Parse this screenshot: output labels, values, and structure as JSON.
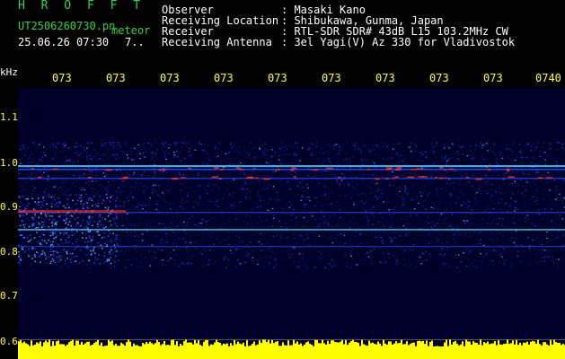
{
  "header": {
    "brand": "H R O F F T",
    "filename": "UT2506260730.pn",
    "meteor_label": "meteor",
    "date_time": "25.06.26 07:30",
    "extra": "7.."
  },
  "info": [
    {
      "key": "Observer",
      "value": ": Masaki Kano"
    },
    {
      "key": "Receiving Location",
      "value": ": Shibukawa, Gunma, Japan"
    },
    {
      "key": "Receiver",
      "value": ": RTL-SDR SDR# 43dB L15 103.2MHz CW"
    },
    {
      "key": "Receiving Antenna",
      "value": ": 3el Yagi(V) Az 330 for Vladivostok"
    }
  ],
  "axis": {
    "y_unit": "kHz",
    "y_ticks": [
      "1.1",
      "1.0",
      "0.9",
      "0.8",
      "0.7",
      "0.6"
    ],
    "x_ticks": [
      "073",
      "073",
      "073",
      "073",
      "073",
      "073",
      "073",
      "073",
      "073",
      "0740"
    ]
  },
  "colors": {
    "header_green": "#2fd24a",
    "tick_yellow": "#ffff33",
    "plot_background": "#00002a",
    "signal_blue": "#2a4cff",
    "signal_cyan": "#5fd0ff",
    "signal_red": "#ff3030",
    "amplitude_yellow": "#ffff00"
  }
}
